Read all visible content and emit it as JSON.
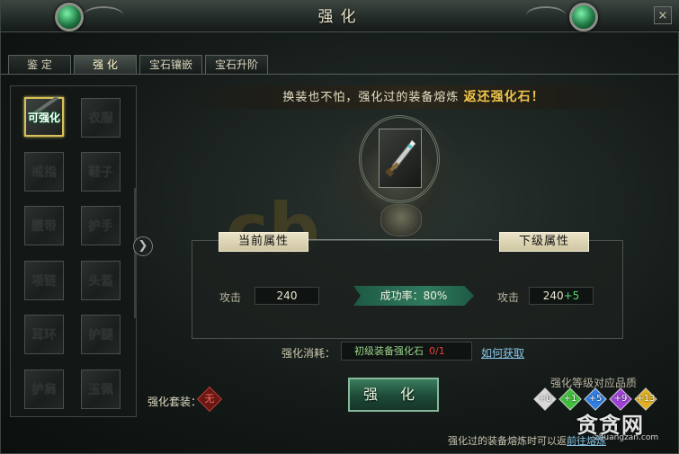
{
  "window": {
    "title": "强化",
    "close_label": "×"
  },
  "tabs": [
    {
      "label": "鉴  定",
      "active": false
    },
    {
      "label": "强 化",
      "active": true
    },
    {
      "label": "宝石镶嵌",
      "active": false
    },
    {
      "label": "宝石升阶",
      "active": false
    }
  ],
  "equipment_slots": [
    {
      "label": "可强化",
      "selected": true
    },
    {
      "label": "衣服"
    },
    {
      "label": "戒指"
    },
    {
      "label": "鞋子"
    },
    {
      "label": "腰带"
    },
    {
      "label": "护手"
    },
    {
      "label": "项链"
    },
    {
      "label": "头盔"
    },
    {
      "label": "耳环"
    },
    {
      "label": "护腿"
    },
    {
      "label": "护肩"
    },
    {
      "label": "玉佩"
    }
  ],
  "banner": {
    "prefix": "换装也不怕，强化过的装备熔炼",
    "highlight": "返还强化石！"
  },
  "current_panel": {
    "title": "当前属性",
    "stat_label": "攻击",
    "stat_value": "240"
  },
  "next_panel": {
    "title": "下级属性",
    "stat_label": "攻击",
    "stat_value": "240",
    "stat_bonus": "+5"
  },
  "success_rate": "成功率：80%",
  "consume": {
    "label": "强化消耗：",
    "item": "初级装备强化石",
    "count": "0/1",
    "link": "如何获取"
  },
  "enhance_button": "强 化",
  "suit": {
    "label": "强化套装：",
    "badge": "无"
  },
  "quality": {
    "title": "强化等级对应品质",
    "gems": [
      {
        "label": "+0",
        "color": "#d9d9d9"
      },
      {
        "label": "+1",
        "color": "#3fbf3a"
      },
      {
        "label": "+5",
        "color": "#2f7ee0"
      },
      {
        "label": "+9",
        "color": "#a040d8"
      },
      {
        "label": "+13",
        "color": "#e0b020"
      }
    ]
  },
  "footer": {
    "text": "强化过的装备熔炼时可以返",
    "link": "前往熔炼"
  },
  "brand": {
    "name": "贪贪网",
    "url": "zhuangzan.com"
  },
  "watermark": "cb"
}
